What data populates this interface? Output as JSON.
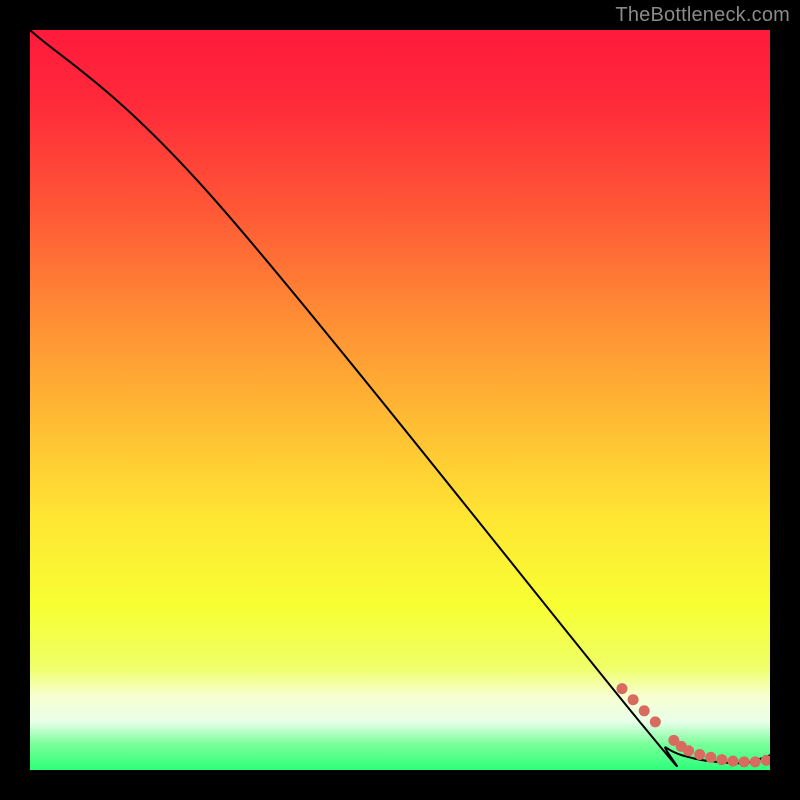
{
  "watermark": "TheBottleneck.com",
  "chart_data": {
    "type": "line",
    "title": "",
    "xlabel": "",
    "ylabel": "",
    "xlim": [
      0,
      100
    ],
    "ylim": [
      0,
      100
    ],
    "series": [
      {
        "name": "curve",
        "x": [
          0,
          25,
          82,
          86,
          90,
          94,
          97,
          100
        ],
        "y": [
          100,
          77,
          7,
          3,
          1.5,
          1,
          1,
          2
        ]
      }
    ],
    "markers": {
      "name": "optimum-points",
      "x": [
        80,
        81.5,
        83,
        84.5,
        87,
        88,
        89,
        90.5,
        92,
        93.5,
        95,
        96.5,
        98,
        99.5
      ],
      "y": [
        11,
        9.5,
        8,
        6.5,
        4,
        3.2,
        2.6,
        2.1,
        1.7,
        1.4,
        1.2,
        1.1,
        1.1,
        1.3
      ]
    },
    "gradient_stops": [
      {
        "offset": 0.0,
        "color": "#ff1a3c"
      },
      {
        "offset": 0.1,
        "color": "#ff2a3a"
      },
      {
        "offset": 0.25,
        "color": "#ff5a36"
      },
      {
        "offset": 0.38,
        "color": "#ff8a34"
      },
      {
        "offset": 0.52,
        "color": "#ffb933"
      },
      {
        "offset": 0.66,
        "color": "#ffe633"
      },
      {
        "offset": 0.78,
        "color": "#f7ff33"
      },
      {
        "offset": 0.86,
        "color": "#efff66"
      },
      {
        "offset": 0.9,
        "color": "#f7ffd0"
      },
      {
        "offset": 0.935,
        "color": "#e8ffe8"
      },
      {
        "offset": 0.965,
        "color": "#7aff9a"
      },
      {
        "offset": 1.0,
        "color": "#2cff7a"
      }
    ],
    "line_color": "#000000",
    "marker_color": "#d86a60"
  }
}
